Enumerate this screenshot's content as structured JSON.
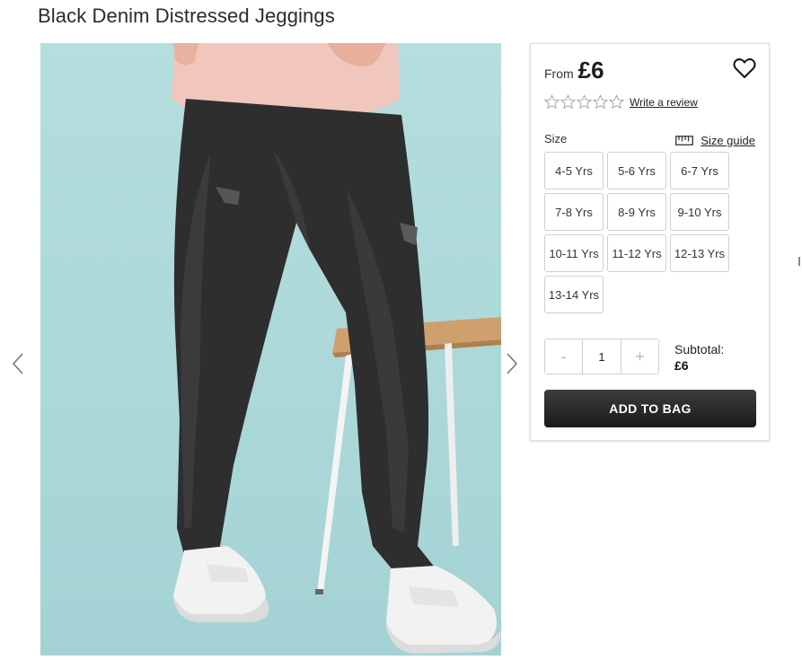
{
  "product": {
    "title": "Black Denim Distressed Jeggings"
  },
  "gallery": {
    "prev_icon": "chevron-left-icon",
    "next_icon": "chevron-right-icon",
    "image_subject": "product-photo"
  },
  "pricing": {
    "from_label": "From",
    "price": "£6"
  },
  "wishlist": {
    "icon": "heart-icon"
  },
  "rating": {
    "stars_filled": 0,
    "stars_total": 5,
    "review_link": "Write a review"
  },
  "sizes": {
    "label": "Size",
    "guide_label": "Size guide",
    "guide_icon": "ruler-icon",
    "options": [
      "4-5 Yrs",
      "5-6 Yrs",
      "6-7 Yrs",
      "7-8 Yrs",
      "8-9 Yrs",
      "9-10 Yrs",
      "10-11 Yrs",
      "11-12 Yrs",
      "12-13 Yrs",
      "13-14 Yrs"
    ]
  },
  "quantity": {
    "decrement": "-",
    "value": "1",
    "increment": "+"
  },
  "subtotal": {
    "label": "Subtotal:",
    "value": "£6"
  },
  "cta": {
    "label": "ADD TO BAG"
  },
  "colors": {
    "button_dark": "#1a1a1a",
    "photo_background": "#acd8d9",
    "border": "#cfcfcf"
  }
}
